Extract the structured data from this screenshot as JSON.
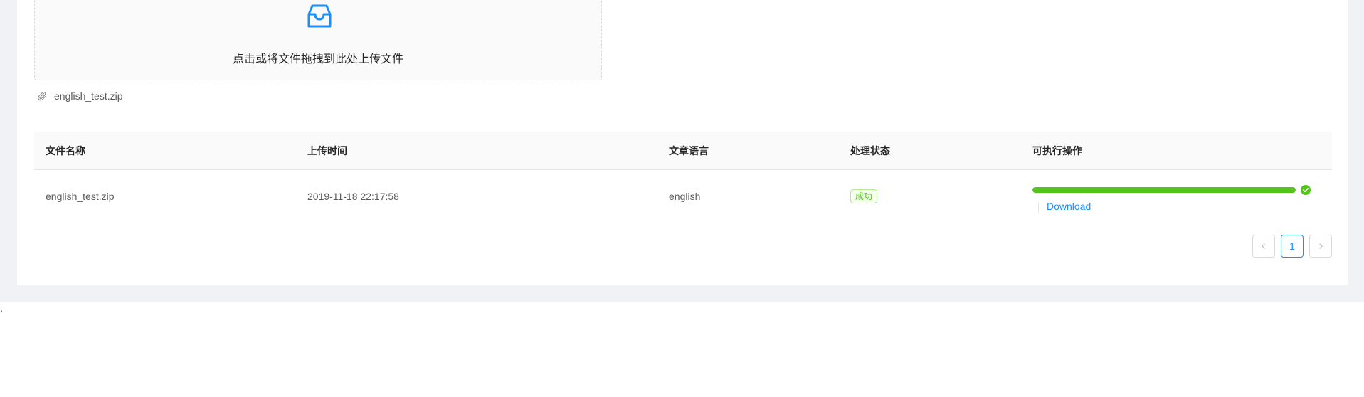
{
  "upload": {
    "hint": "点击或将文件拖拽到此处上传文件",
    "uploaded_file": "english_test.zip"
  },
  "table": {
    "headers": [
      "文件名称",
      "上传时间",
      "文章语言",
      "处理状态",
      "可执行操作"
    ],
    "rows": [
      {
        "file_name": "english_test.zip",
        "upload_time": "2019-11-18 22:17:58",
        "language": "english",
        "status": "成功",
        "progress_percent": 100,
        "action_label": "Download"
      }
    ]
  },
  "pagination": {
    "current_page": "1"
  },
  "stray_text": "'",
  "colors": {
    "accent": "#1890ff",
    "success": "#52c41a",
    "page_bg": "#f0f2f5"
  },
  "icons": {
    "dragger": "inbox-icon",
    "uploaded_item": "paper-clip-icon",
    "progress_done": "check-circle-icon",
    "prev": "chevron-left-icon",
    "next": "chevron-right-icon"
  }
}
